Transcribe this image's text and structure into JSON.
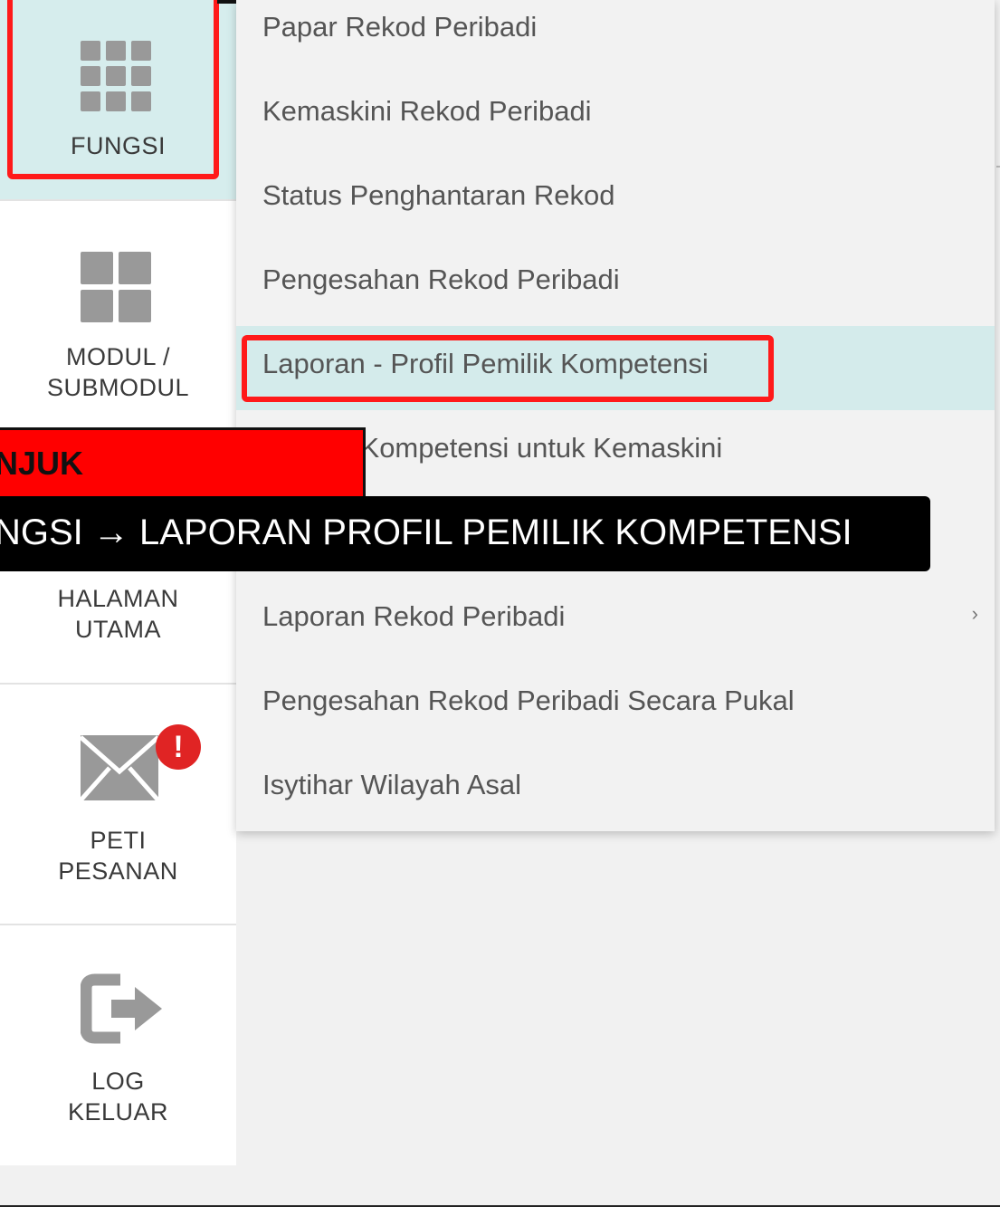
{
  "sidebar": {
    "fungsi": {
      "label": "FUNGSI",
      "icon": "grid-icon"
    },
    "modul": {
      "label_line1": "MODUL /",
      "label_line2": "SUBMODUL",
      "icon": "modules-icon"
    },
    "halaman": {
      "label_line1": "HALAMAN",
      "label_line2": "UTAMA"
    },
    "peti": {
      "label_line1": "PETI",
      "label_line2": "PESANAN",
      "icon": "mail-icon",
      "badge": "!"
    },
    "log": {
      "label_line1": "LOG",
      "label_line2": "KELUAR",
      "icon": "logout-icon"
    }
  },
  "submenu": {
    "items": [
      {
        "label": "Papar Rekod Peribadi"
      },
      {
        "label": "Kemaskini Rekod Peribadi"
      },
      {
        "label": "Status Penghantaran Rekod"
      },
      {
        "label": "Pengesahan Rekod Peribadi"
      },
      {
        "label": "Laporan - Profil Pemilik Kompetensi",
        "active": true
      },
      {
        "label": "Pemilik Kompetensi untuk Kemaskini"
      },
      {
        "label": "Laporan Rekod Peribadi",
        "has_submenu": true,
        "chevron": "›"
      },
      {
        "label": "Pengesahan Rekod Peribadi Secara Pukal"
      },
      {
        "label": "Isytihar Wilayah Asal"
      }
    ]
  },
  "overlay": {
    "heading": "NJUK",
    "path": "NGSI → LAPORAN PROFIL PEMILIK KOMPETENSI"
  },
  "colors": {
    "highlight": "#ff1a1a",
    "active_bg": "#d4ebeb",
    "badge": "#e02424"
  }
}
